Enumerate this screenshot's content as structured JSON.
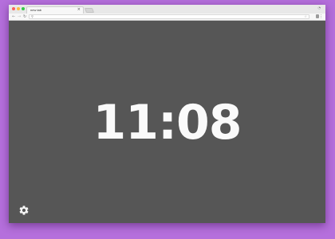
{
  "browser": {
    "tab_title": "new tab",
    "tab_close": "×",
    "omnibox_placeholder": "",
    "nav": {
      "back": "←",
      "forward": "→",
      "reload": "↻"
    }
  },
  "clock": {
    "time": "11:08"
  },
  "icons": {
    "settings": "gear-icon",
    "search": "search-icon",
    "star": "star-icon",
    "menu": "kebab-menu-icon"
  },
  "colors": {
    "desktop_background": "#b56fdc",
    "page_background": "#565656",
    "clock_text": "#fafafa"
  }
}
